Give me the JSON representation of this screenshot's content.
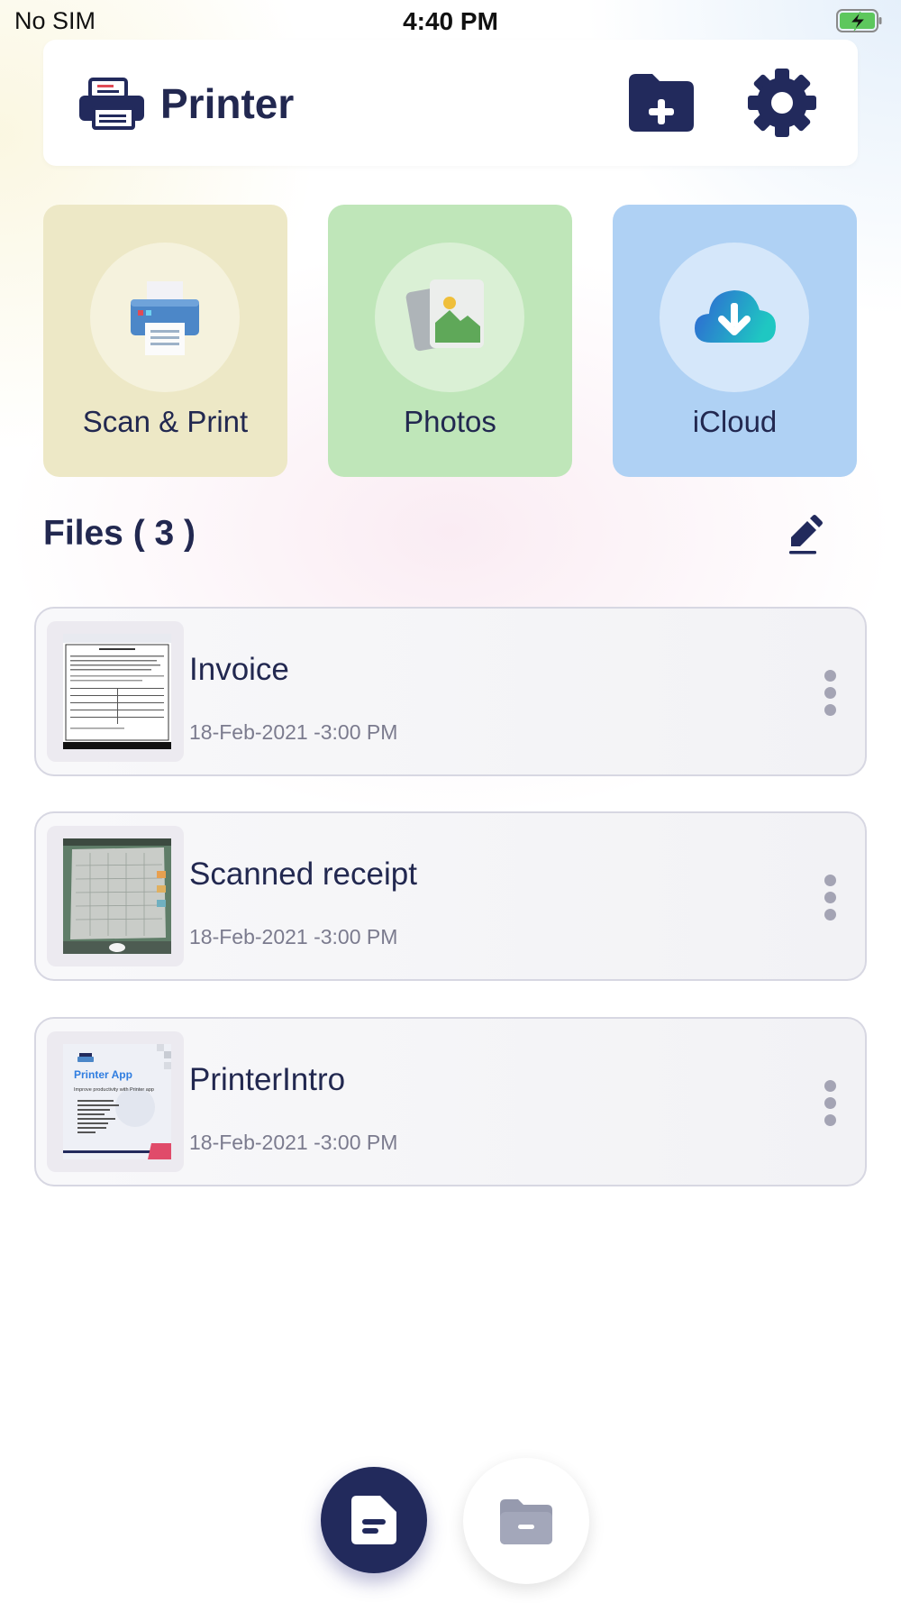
{
  "status_bar": {
    "carrier": "No SIM",
    "time": "4:40 PM",
    "battery_icon": "battery-charging-icon"
  },
  "header": {
    "title": "Printer",
    "logo_icon": "printer-logo-icon",
    "add_folder_icon": "folder-plus-icon",
    "settings_icon": "gear-icon"
  },
  "actions": [
    {
      "label": "Scan & Print",
      "icon": "printer-icon",
      "color": "#ede8c6"
    },
    {
      "label": "Photos",
      "icon": "photos-icon",
      "color": "#bfe6b9"
    },
    {
      "label": "iCloud",
      "icon": "cloud-download-icon",
      "color": "#afd1f4"
    }
  ],
  "files": {
    "title": "Files ( 3 )",
    "edit_icon": "pencil-icon",
    "items": [
      {
        "name": "Invoice",
        "date": "18-Feb-2021 -3:00 PM"
      },
      {
        "name": "Scanned receipt",
        "date": "18-Feb-2021 -3:00 PM"
      },
      {
        "name": "PrinterIntro",
        "date": "18-Feb-2021 -3:00 PM",
        "thumb_title": "Printer App",
        "thumb_subtitle": "Improve productivity with Printer app"
      }
    ]
  },
  "bottom_bar": {
    "active_tab": "documents",
    "tabs": [
      "document-icon",
      "folder-icon"
    ]
  },
  "colors": {
    "primary": "#222a5c",
    "text": "#222850",
    "muted": "#7b7b8e"
  }
}
